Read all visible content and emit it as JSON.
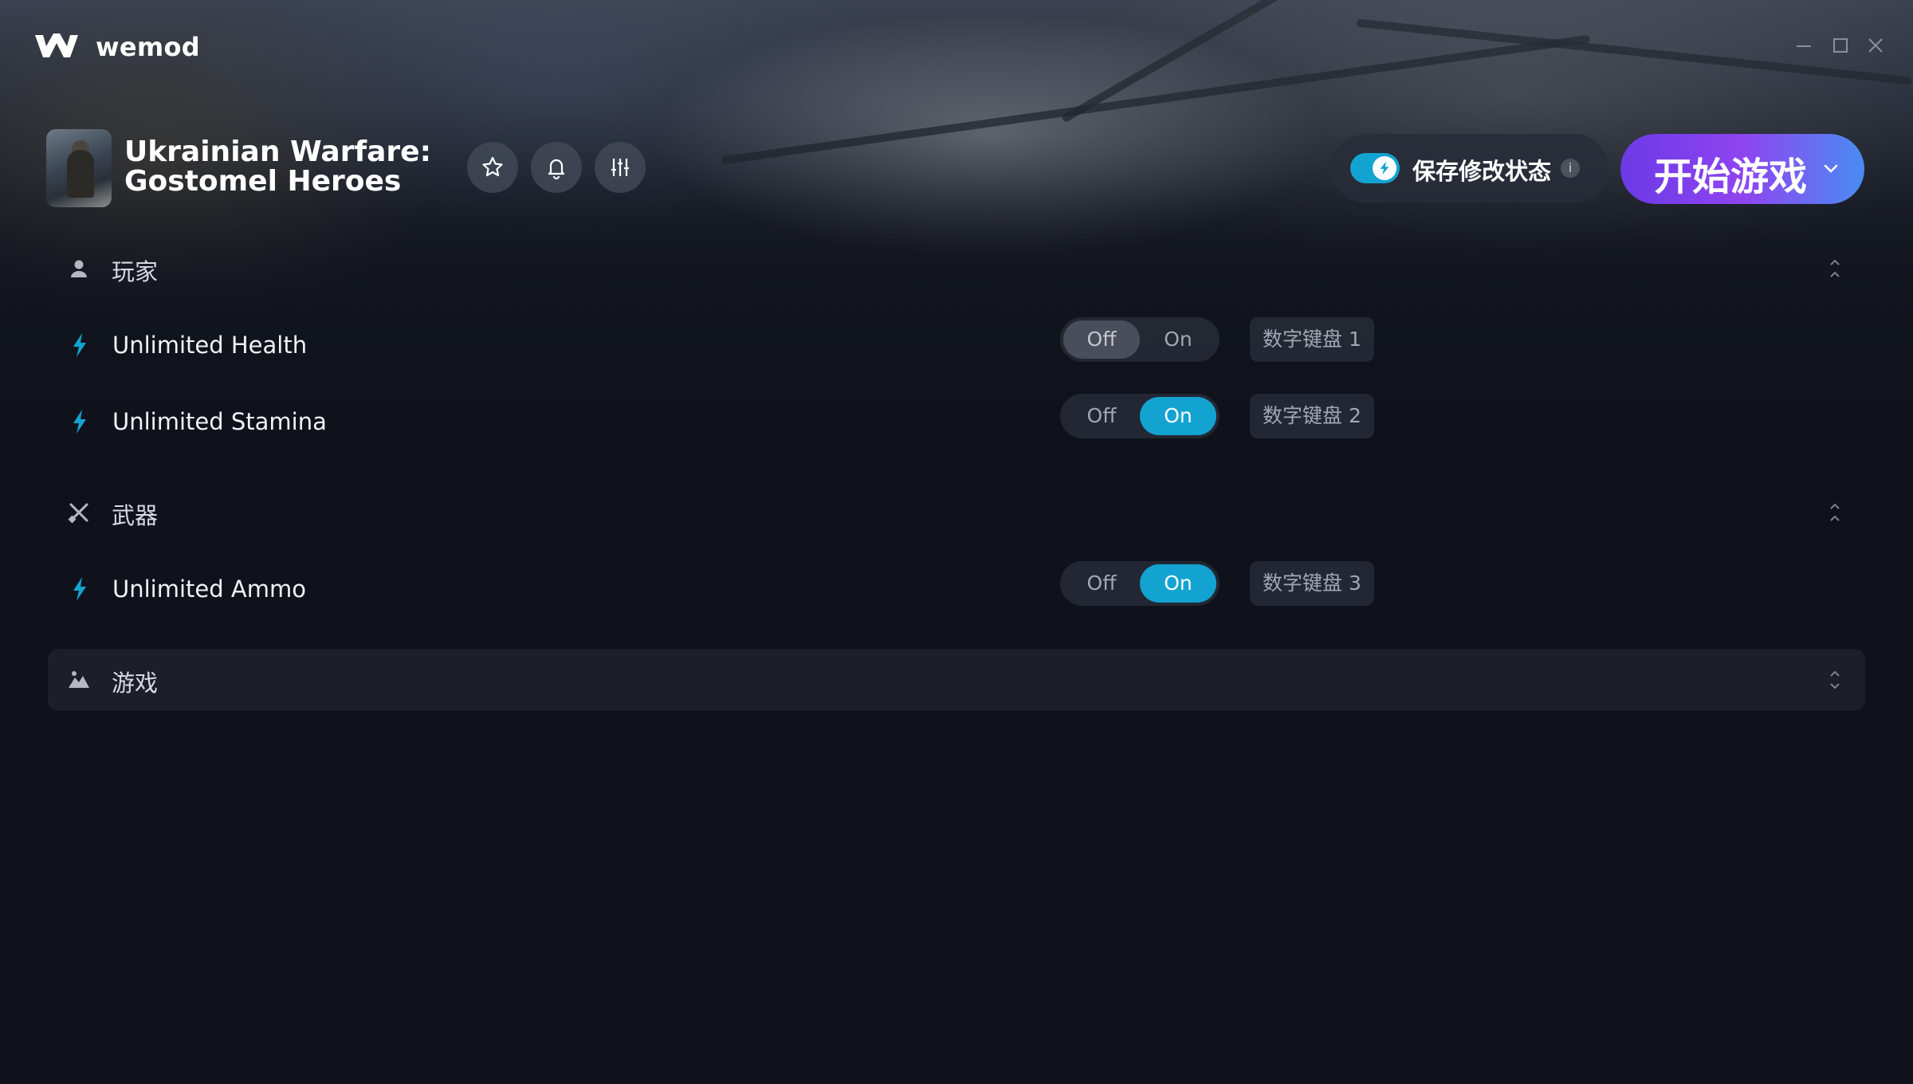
{
  "app": {
    "brand": "wemod",
    "colors": {
      "accent": "#13a3d1",
      "play_gradient_start": "#6b3ae6",
      "play_gradient_end": "#4a8cf2",
      "background": "#0f121b"
    }
  },
  "window_controls": {
    "minimize_icon": "minimize-icon",
    "maximize_icon": "maximize-icon",
    "close_icon": "close-icon"
  },
  "game": {
    "title_line1": "Ukrainian Warfare:",
    "title_line2": "Gostomel Heroes",
    "actions": [
      "star-icon",
      "bell-icon",
      "sliders-icon"
    ]
  },
  "save_mods": {
    "label": "保存修改状态",
    "enabled": true,
    "info": "i"
  },
  "play": {
    "label": "开始游戏"
  },
  "sections": [
    {
      "label": "玩家",
      "icon": "user-icon",
      "cheats": [
        {
          "label": "Unlimited Health",
          "off": "Off",
          "on": "On",
          "state": "off",
          "hotkey": "数字键盘 1"
        },
        {
          "label": "Unlimited Stamina",
          "off": "Off",
          "on": "On",
          "state": "on",
          "hotkey": "数字键盘 2"
        }
      ]
    },
    {
      "label": "武器",
      "icon": "crossed-swords-icon",
      "cheats": [
        {
          "label": "Unlimited Ammo",
          "off": "Off",
          "on": "On",
          "state": "on",
          "hotkey": "数字键盘 3"
        }
      ]
    },
    {
      "label": "游戏",
      "icon": "landscape-icon",
      "cheats": []
    }
  ]
}
